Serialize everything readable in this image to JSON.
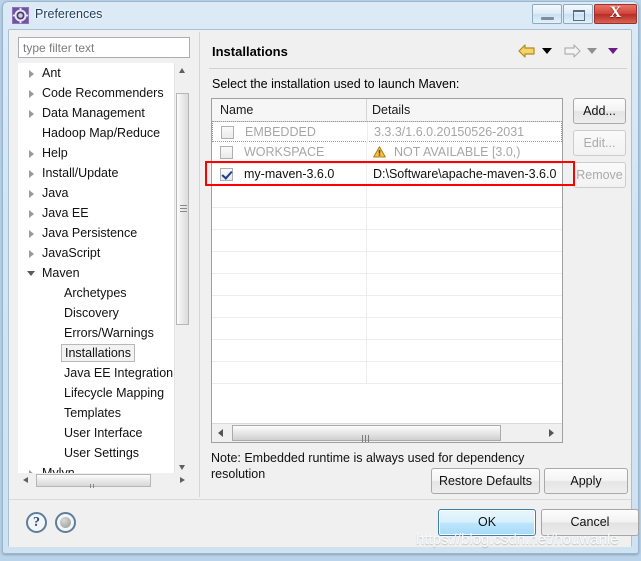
{
  "window": {
    "title": "Preferences",
    "icon": "preferences-gear-icon",
    "buttons": {
      "minimize": "minimize-button",
      "maximize": "maximize-button",
      "close_label": "X"
    }
  },
  "sidebar": {
    "filter": {
      "placeholder": "type filter text",
      "value": ""
    },
    "items": [
      {
        "label": "Ant",
        "level": 1,
        "twisty": "collapsed",
        "selected": false
      },
      {
        "label": "Code Recommenders",
        "level": 1,
        "twisty": "collapsed",
        "selected": false
      },
      {
        "label": "Data Management",
        "level": 1,
        "twisty": "collapsed",
        "selected": false
      },
      {
        "label": "Hadoop Map/Reduce",
        "level": 1,
        "twisty": "none",
        "selected": false
      },
      {
        "label": "Help",
        "level": 1,
        "twisty": "collapsed",
        "selected": false
      },
      {
        "label": "Install/Update",
        "level": 1,
        "twisty": "collapsed",
        "selected": false
      },
      {
        "label": "Java",
        "level": 1,
        "twisty": "collapsed",
        "selected": false
      },
      {
        "label": "Java EE",
        "level": 1,
        "twisty": "collapsed",
        "selected": false
      },
      {
        "label": "Java Persistence",
        "level": 1,
        "twisty": "collapsed",
        "selected": false
      },
      {
        "label": "JavaScript",
        "level": 1,
        "twisty": "collapsed",
        "selected": false
      },
      {
        "label": "Maven",
        "level": 1,
        "twisty": "expanded",
        "selected": false
      },
      {
        "label": "Archetypes",
        "level": 2,
        "twisty": "none",
        "selected": false
      },
      {
        "label": "Discovery",
        "level": 2,
        "twisty": "none",
        "selected": false
      },
      {
        "label": "Errors/Warnings",
        "level": 2,
        "twisty": "none",
        "selected": false
      },
      {
        "label": "Installations",
        "level": 2,
        "twisty": "none",
        "selected": true
      },
      {
        "label": "Java EE Integration",
        "level": 2,
        "twisty": "none",
        "selected": false
      },
      {
        "label": "Lifecycle Mapping",
        "level": 2,
        "twisty": "none",
        "selected": false
      },
      {
        "label": "Templates",
        "level": 2,
        "twisty": "none",
        "selected": false
      },
      {
        "label": "User Interface",
        "level": 2,
        "twisty": "none",
        "selected": false
      },
      {
        "label": "User Settings",
        "level": 2,
        "twisty": "none",
        "selected": false
      },
      {
        "label": "Mylyn",
        "level": 1,
        "twisty": "collapsed",
        "selected": false
      }
    ]
  },
  "page": {
    "title": "Installations",
    "instruction": "Select the installation used to launch Maven:",
    "note": "Note: Embedded runtime is always used for dependency resolution"
  },
  "navigation": {
    "back_icon": "back-arrow-icon",
    "back_menu_icon": "chevron-down-icon",
    "forward_icon": "forward-arrow-icon",
    "forward_menu_icon": "chevron-down-icon",
    "view_menu_icon": "chevron-down-icon"
  },
  "table": {
    "columns": [
      "Name",
      "Details"
    ],
    "rows": [
      {
        "checked": false,
        "name": "EMBEDDED",
        "details": "3.3.3/1.6.0.20150526-2031",
        "enabled": false,
        "focus_outline": true,
        "warning": false
      },
      {
        "checked": false,
        "name": "WORKSPACE",
        "details": "NOT AVAILABLE [3.0,)",
        "enabled": false,
        "focus_outline": false,
        "warning": true,
        "warning_icon": "warning-triangle-icon"
      },
      {
        "checked": true,
        "name": "my-maven-3.6.0",
        "details": "D:\\Software\\apache-maven-3.6.0",
        "enabled": true,
        "focus_outline": false,
        "warning": false,
        "highlighted": true
      }
    ],
    "empty_row_count": 9,
    "highlight_color": "#ff0000"
  },
  "side_buttons": [
    {
      "label": "Add...",
      "enabled": true
    },
    {
      "label": "Edit...",
      "enabled": false
    },
    {
      "label": "Remove",
      "enabled": false
    }
  ],
  "page_buttons": {
    "restore_defaults": "Restore Defaults",
    "apply": "Apply"
  },
  "footer": {
    "help_icon": "help-question-icon",
    "help_glyph": "?",
    "restore_icon": "restore-defaults-circle-icon",
    "ok": "OK",
    "cancel": "Cancel"
  },
  "watermark": "https://blog.csdn.net/houwanle"
}
